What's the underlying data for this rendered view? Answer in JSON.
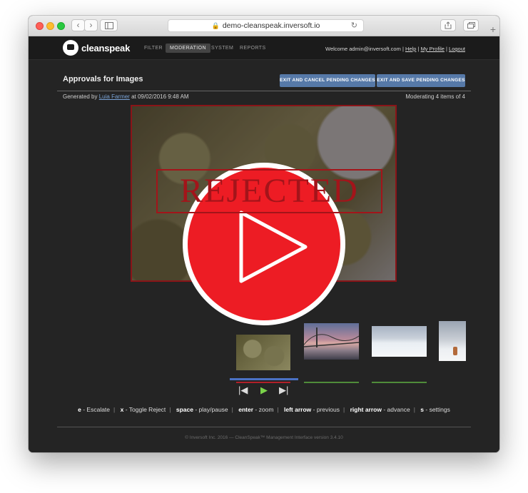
{
  "browser": {
    "url": "demo-cleanspeak.inversoft.io",
    "back_icon": "chevron-left-icon",
    "forward_icon": "chevron-right-icon"
  },
  "app": {
    "logo_text": "cleanspeak",
    "nav": [
      {
        "label": "FILTER",
        "active": false
      },
      {
        "label": "MODERATION",
        "active": true
      },
      {
        "label": "SYSTEM",
        "active": false
      },
      {
        "label": "REPORTS",
        "active": false
      }
    ],
    "welcome": "Welcome admin@inversoft.com",
    "links": {
      "help": "Help",
      "profile": "My Profile",
      "logout": "Logout"
    },
    "sep": "|"
  },
  "page": {
    "title": "Approvals for Images",
    "buttons": {
      "cancel": "EXIT AND CANCEL PENDING CHANGES",
      "save": "EXIT AND SAVE PENDING CHANGES"
    },
    "generated_prefix": "Generated by",
    "generated_user": "Luia Farmer",
    "generated_suffix": "at 09/02/2016 9:48 AM",
    "moderating": "Moderating 4 items of 4"
  },
  "main_image": {
    "stamp_text": "REJECTED",
    "status_color": "#a3141a"
  },
  "thumbnails": [
    {
      "name": "cannabis",
      "status": "rejected",
      "bar_color": "#b0202a"
    },
    {
      "name": "bridge",
      "status": "approved",
      "bar_color": "#4f8c3a"
    },
    {
      "name": "snow-field",
      "status": "approved",
      "bar_color": "#4f8c3a"
    },
    {
      "name": "snow-person",
      "status": "none",
      "bar_color": ""
    }
  ],
  "controls": {
    "prev": "|◀",
    "play": "▶",
    "next": "▶|"
  },
  "shortcuts": [
    {
      "key": "e",
      "action": "Escalate"
    },
    {
      "key": "x",
      "action": "Toggle Reject"
    },
    {
      "key": "space",
      "action": "play/pause"
    },
    {
      "key": "enter",
      "action": "zoom"
    },
    {
      "key": "left arrow",
      "action": "previous"
    },
    {
      "key": "right arrow",
      "action": "advance"
    },
    {
      "key": "s",
      "action": "settings"
    }
  ],
  "footer": "© Inversoft Inc. 2016 — CleanSpeak™ Management Interface version 3.4.10",
  "overlay": {
    "icon": "play-icon",
    "color": "#ed1c24"
  }
}
